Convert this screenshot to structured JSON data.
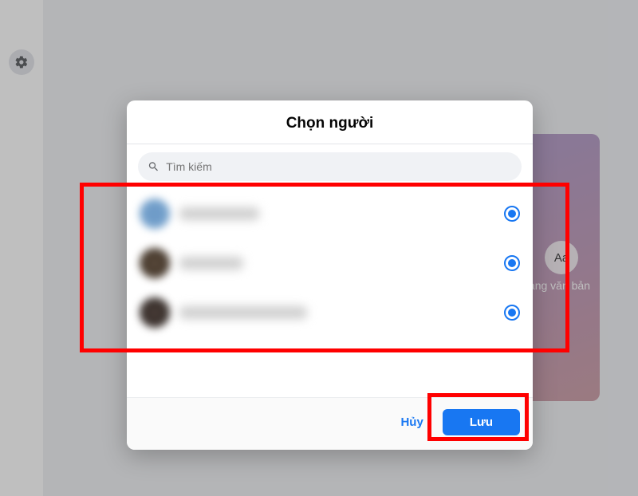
{
  "sidebar": {
    "settings_icon_name": "gear-icon"
  },
  "background_card": {
    "badge": "Aa",
    "caption": "dạng văn bản"
  },
  "modal": {
    "title": "Chọn người",
    "search_placeholder": "Tìm kiếm"
  },
  "list": {
    "items": [
      {
        "selected": true
      },
      {
        "selected": true
      },
      {
        "selected": true
      }
    ]
  },
  "footer": {
    "cancel_label": "Hủy",
    "save_label": "Lưu"
  },
  "annotations": {
    "list_highlight": true,
    "save_highlight": true
  }
}
